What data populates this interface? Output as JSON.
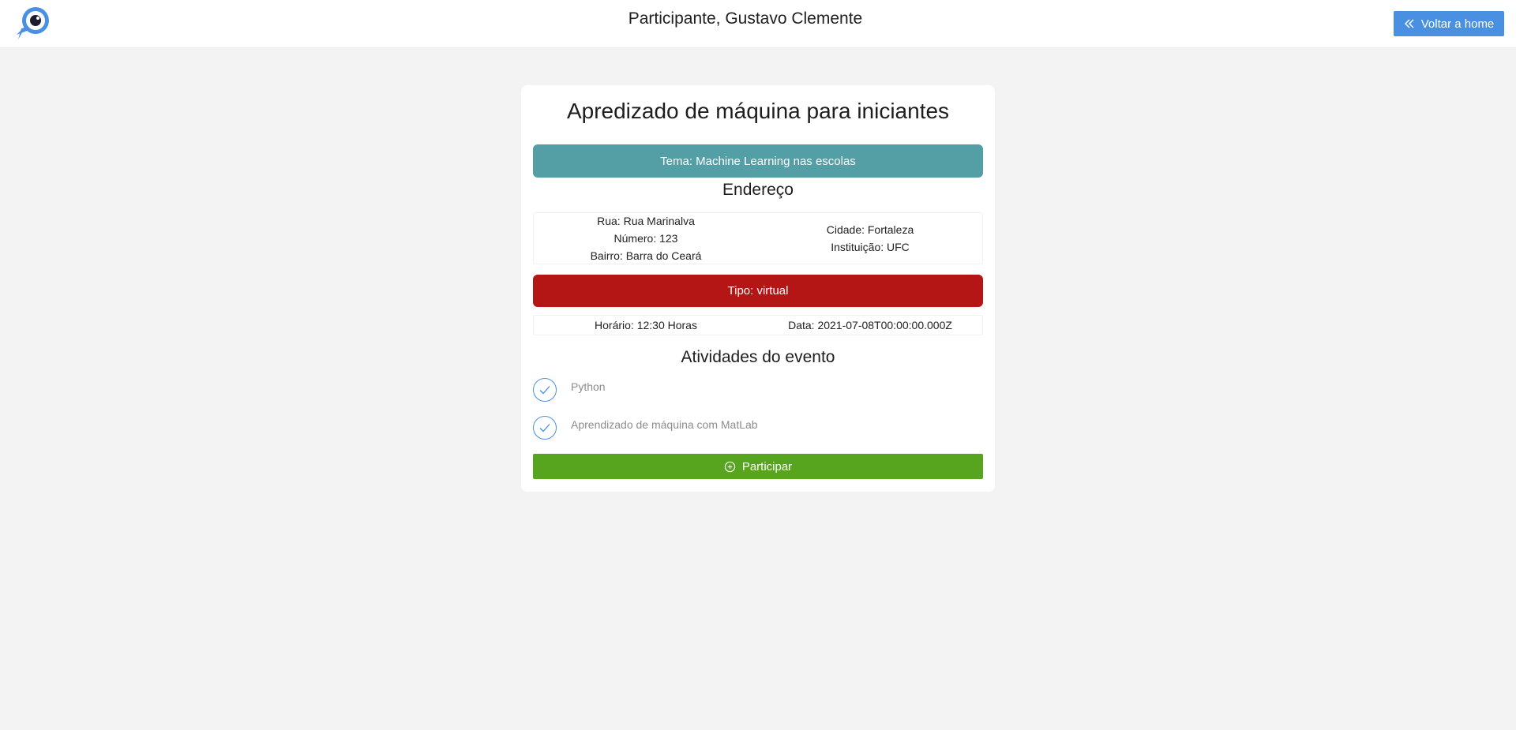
{
  "header": {
    "title": "Participante, Gustavo Clemente",
    "home_button_label": "Voltar a home",
    "logo_icon": "rocket-eye-logo-icon",
    "home_button_icon": "double-chevron-left-icon"
  },
  "event": {
    "title": "Apredizado de máquina para iniciantes",
    "theme": "Tema: Machine Learning nas escolas",
    "address_heading": "Endereço",
    "address": {
      "street": "Rua: Rua Marinalva",
      "number": "Número: 123",
      "neighborhood": "Bairro: Barra do Ceará",
      "city": "Cidade: Fortaleza",
      "institution": "Instituição: UFC"
    },
    "type": "Tipo: virtual",
    "time": "Horário: 12:30 Horas",
    "date": "Data: 2021-07-08T00:00:00.000Z",
    "activities_heading": "Atividades do evento",
    "activities": [
      {
        "label": "Python",
        "icon": "check-icon"
      },
      {
        "label": "Aprendizado de máquina com MatLab",
        "icon": "check-icon"
      }
    ],
    "participate_label": "Participar",
    "participate_icon": "plus-circle-icon"
  },
  "colors": {
    "page_background": "#f3f3f3",
    "primary_blue": "#4a90e2",
    "theme_teal": "#549ea5",
    "type_red": "#b41616",
    "participate_green": "#57a51f"
  }
}
